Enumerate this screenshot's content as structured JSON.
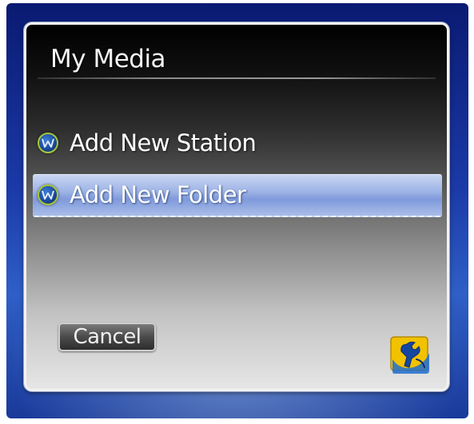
{
  "dialog": {
    "title": "My Media",
    "menu_items": [
      {
        "label": "Add New Station",
        "icon": "station-icon",
        "selected": false
      },
      {
        "label": "Add New Folder",
        "icon": "folder-icon",
        "selected": true
      }
    ],
    "cancel_label": "Cancel",
    "tools_icon": "wrench-icon"
  },
  "colors": {
    "selection_highlight": "#9fb5e6",
    "background_blue": "#1b3aa8",
    "icon_ring": "#a6c63a",
    "tools_icon_yellow": "#f2c200"
  }
}
